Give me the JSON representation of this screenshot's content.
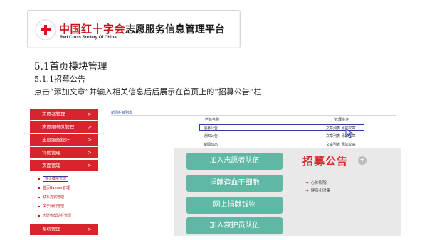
{
  "banner": {
    "brand_cn": "中国红十字会",
    "brand_en": "Red Cross Society Of China",
    "title": "志愿服务信息管理平台"
  },
  "doc": {
    "section_heading": "5.1首页模块管理",
    "sub_heading": "5.1.1招募公告",
    "paragraph": "点击“添加文章”并输入相关信息后后展示在首页上的“招募公告”栏"
  },
  "sidebar": {
    "items": [
      {
        "label": "志愿者管理",
        "arrow": ">"
      },
      {
        "label": "志愿服务队管理",
        "arrow": ">"
      },
      {
        "label": "志愿服务统计",
        "arrow": ">"
      },
      {
        "label": "评优管理",
        "arrow": ">"
      },
      {
        "label": "页面管理",
        "arrow": ">"
      }
    ],
    "sub_items": [
      "首页模块管理",
      "首页Banner管理",
      "联系方式管理",
      "关于我们管理",
      "志愿者帮助栏管理"
    ],
    "last_item": {
      "label": "系统管理",
      "arrow": ">"
    }
  },
  "table": {
    "caption": "新闻栏目列表",
    "headers": [
      "栏目名称",
      "管理操作"
    ],
    "rows": [
      {
        "name": "招募公告",
        "op": "文章列表 添加文章"
      },
      {
        "name": "通知公告",
        "op": "文章列表 添加文章"
      },
      {
        "name": "新闻动态",
        "op": "文章列表 添加文章"
      }
    ]
  },
  "popup": {
    "buttons": [
      "加入志愿者队伍",
      "捐献造血干细胞",
      "网上捐献钱物",
      "加入救护员队伍"
    ],
    "recruit_title": "招募公告",
    "plus": "+",
    "notices": [
      "心肺影院",
      "健康小时集"
    ]
  },
  "colors": {
    "brand_red": "#d8242c",
    "button_teal": "#5eb8a3",
    "highlight_blue": "#2b3ca8"
  }
}
